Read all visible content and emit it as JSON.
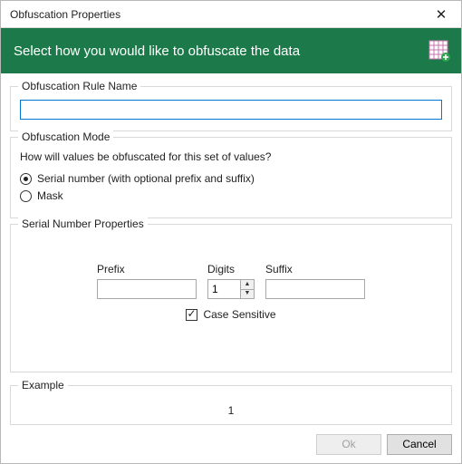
{
  "window": {
    "title": "Obfuscation Properties"
  },
  "header": {
    "subtitle": "Select how you would like to obfuscate the data"
  },
  "ruleName": {
    "legend": "Obfuscation Rule Name",
    "value": ""
  },
  "mode": {
    "legend": "Obfuscation Mode",
    "question": "How will values be obfuscated for this set of values?",
    "optionSerial": "Serial number (with optional prefix and suffix)",
    "optionMask": "Mask",
    "selected": "serial"
  },
  "serial": {
    "legend": "Serial Number Properties",
    "prefixLabel": "Prefix",
    "prefixValue": "",
    "digitsLabel": "Digits",
    "digitsValue": "1",
    "suffixLabel": "Suffix",
    "suffixValue": "",
    "caseSensitiveLabel": "Case Sensitive",
    "caseSensitive": true
  },
  "example": {
    "legend": "Example",
    "value": "1"
  },
  "buttons": {
    "ok": "Ok",
    "cancel": "Cancel"
  }
}
